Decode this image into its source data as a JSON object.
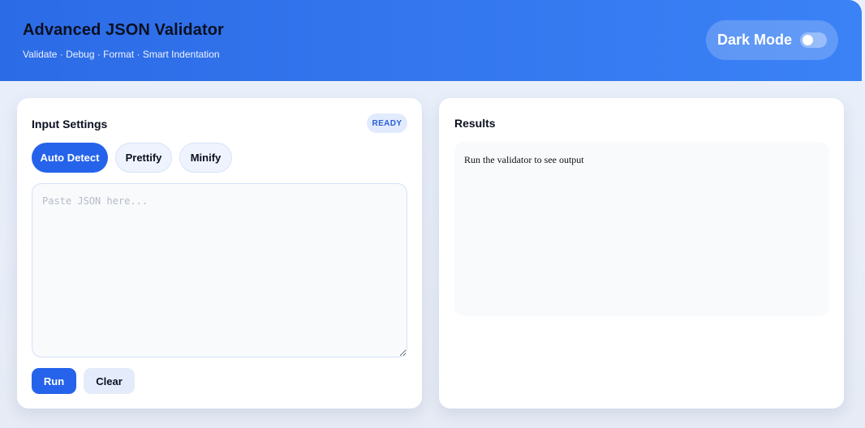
{
  "header": {
    "title": "Advanced JSON Validator",
    "subtitle": "Validate · Debug · Format · Smart Indentation",
    "dark_mode_label": "Dark Mode",
    "dark_mode_on": false
  },
  "input_panel": {
    "title": "Input Settings",
    "status_badge": "READY",
    "modes": [
      {
        "label": "Auto Detect",
        "selected": true
      },
      {
        "label": "Prettify",
        "selected": false
      },
      {
        "label": "Minify",
        "selected": false
      }
    ],
    "textarea": {
      "value": "",
      "placeholder": "Paste JSON here..."
    },
    "run_label": "Run",
    "clear_label": "Clear"
  },
  "results_panel": {
    "title": "Results",
    "output_text": "Run the validator to see output"
  },
  "colors": {
    "accent": "#2563eb",
    "header_start": "#2c6be6",
    "header_end": "#3b82f6",
    "badge_bg": "#e2ebfd",
    "badge_text": "#2a5fd6"
  }
}
